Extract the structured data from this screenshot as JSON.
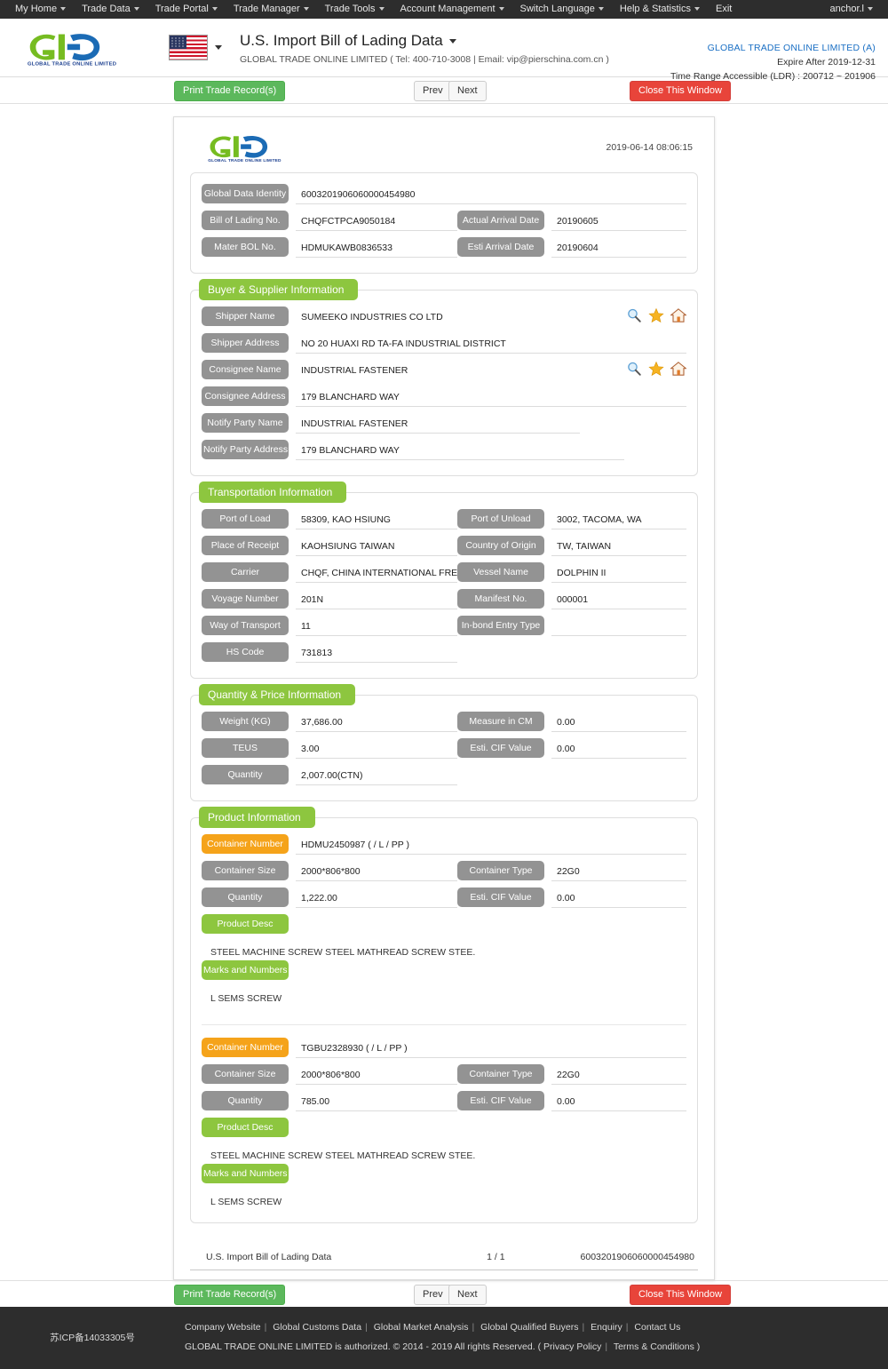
{
  "topnav": {
    "items": [
      {
        "label": "My Home",
        "caret": true
      },
      {
        "label": "Trade Data",
        "caret": true
      },
      {
        "label": "Trade Portal",
        "caret": true
      },
      {
        "label": "Trade Manager",
        "caret": true
      },
      {
        "label": "Trade Tools",
        "caret": true
      },
      {
        "label": "Account Management",
        "caret": true
      },
      {
        "label": "Switch Language",
        "caret": true
      },
      {
        "label": "Help & Statistics",
        "caret": true
      },
      {
        "label": "Exit",
        "caret": false
      }
    ],
    "user": "anchor.l"
  },
  "header": {
    "logo_text": "GLOBAL TRADE ONLINE LIMITED",
    "title": "U.S. Import Bill of Lading Data",
    "subtitle": "GLOBAL TRADE ONLINE LIMITED ( Tel: 400-710-3008 | Email: vip@pierschina.com.cn )",
    "account_name": "GLOBAL TRADE ONLINE LIMITED (A)",
    "expire": "Expire After 2019-12-31",
    "time_range": "Time Range Accessible (LDR) : 200712 ~ 201906",
    "flag": "us-flag-icon"
  },
  "toolbar": {
    "print_label": "Print Trade Record(s)",
    "prev_label": "Prev",
    "next_label": "Next",
    "close_label": "Close This Window"
  },
  "sheet": {
    "timestamp": "2019-06-14 08:06:15",
    "identity": {
      "rows": [
        {
          "label": "Global Data Identity",
          "value": "6003201906060000454980",
          "label2": "",
          "value2": ""
        },
        {
          "label": "Bill of Lading No.",
          "value": "CHQFCTPCA9050184",
          "label2": "Actual Arrival Date",
          "value2": "20190605"
        },
        {
          "label": "Mater BOL No.",
          "value": "HDMUKAWB0836533",
          "label2": "Esti Arrival Date",
          "value2": "20190604"
        }
      ]
    },
    "buyer_supplier": {
      "title": "Buyer & Supplier Information",
      "shipper_name_label": "Shipper Name",
      "shipper_name": "SUMEEKO INDUSTRIES CO LTD",
      "shipper_address_label": "Shipper Address",
      "shipper_address": "NO 20 HUAXI RD TA-FA INDUSTRIAL DISTRICT",
      "consignee_name_label": "Consignee Name",
      "consignee_name": "INDUSTRIAL FASTENER",
      "consignee_address_label": "Consignee Address",
      "consignee_address": "179 BLANCHARD WAY",
      "notify_name_label": "Notify Party Name",
      "notify_name": "INDUSTRIAL FASTENER",
      "notify_address_label": "Notify Party Address",
      "notify_address": "179 BLANCHARD WAY"
    },
    "transportation": {
      "title": "Transportation Information",
      "rows": [
        {
          "label": "Port of Load",
          "value": "58309, KAO HSIUNG",
          "label2": "Port of Unload",
          "value2": "3002, TACOMA, WA"
        },
        {
          "label": "Place of Receipt",
          "value": "KAOHSIUNG TAIWAN",
          "label2": "Country of Origin",
          "value2": "TW, TAIWAN"
        },
        {
          "label": "Carrier",
          "value": "CHQF, CHINA INTERNATIONAL FREIGHT",
          "label2": "Vessel Name",
          "value2": "DOLPHIN II"
        },
        {
          "label": "Voyage Number",
          "value": "201N",
          "label2": "Manifest No.",
          "value2": "000001"
        },
        {
          "label": "Way of Transport",
          "value": "11",
          "label2": "In-bond Entry Type",
          "value2": ""
        },
        {
          "label": "HS Code",
          "value": "731813",
          "label2": "",
          "value2": ""
        }
      ]
    },
    "quantity_price": {
      "title": "Quantity & Price Information",
      "rows": [
        {
          "label": "Weight (KG)",
          "value": "37,686.00",
          "label2": "Measure in CM",
          "value2": "0.00"
        },
        {
          "label": "TEUS",
          "value": "3.00",
          "label2": "Esti. CIF Value",
          "value2": "0.00"
        },
        {
          "label": "Quantity",
          "value": "2,007.00(CTN)",
          "label2": "",
          "value2": ""
        }
      ]
    },
    "product": {
      "title": "Product Information",
      "container_number_label": "Container Number",
      "container_size_label": "Container Size",
      "container_type_label": "Container Type",
      "quantity_label": "Quantity",
      "cif_label": "Esti. CIF Value",
      "product_desc_label": "Product Desc",
      "marks_label": "Marks and Numbers",
      "items": [
        {
          "container_number": "HDMU2450987 ( / L / PP )",
          "container_size": "2000*806*800",
          "container_type": "22G0",
          "quantity": "1,222.00",
          "cif_value": "0.00",
          "product_desc": "STEEL MACHINE SCREW STEEL MATHREAD SCREW STEE.",
          "marks": "L SEMS SCREW"
        },
        {
          "container_number": "TGBU2328930 ( / L / PP )",
          "container_size": "2000*806*800",
          "container_type": "22G0",
          "quantity": "785.00",
          "cif_value": "0.00",
          "product_desc": "STEEL MACHINE SCREW STEEL MATHREAD SCREW STEE.",
          "marks": "L SEMS SCREW"
        }
      ]
    },
    "footer": {
      "doc_name": "U.S. Import Bill of Lading Data",
      "page": "1 / 1",
      "identity": "6003201906060000454980"
    }
  },
  "footer": {
    "icp": "苏ICP备14033305号",
    "links": [
      "Company Website",
      "Global Customs Data",
      "Global Market Analysis",
      "Global Qualified Buyers",
      "Enquiry",
      "Contact Us"
    ],
    "copyright_pre": "GLOBAL TRADE ONLINE LIMITED is authorized. © 2014 - 2019 All rights Reserved.  (",
    "privacy": "Privacy Policy",
    "terms": "Terms & Conditions",
    "copyright_post": ")"
  },
  "colors": {
    "green": "#8dc63f",
    "orange": "#f5a31a",
    "grey_label": "#939393",
    "nav_dark": "#2d2d2d",
    "link_blue": "#1a6fc4",
    "btn_green": "#5cb85c",
    "btn_red": "#e8443a"
  }
}
